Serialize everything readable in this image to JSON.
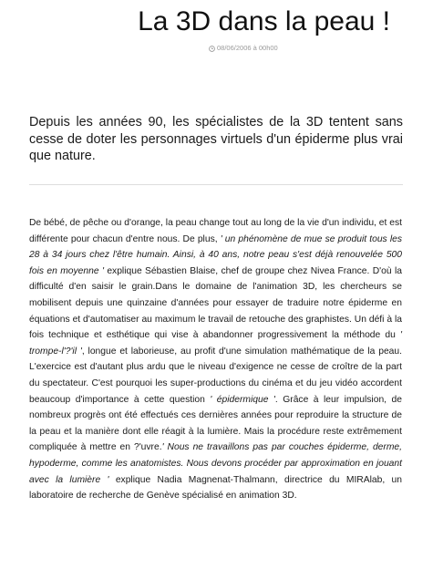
{
  "article": {
    "title": "La 3D dans la peau !",
    "date": "08/06/2006 à 00h00",
    "lead": "Depuis les années 90, les spécialistes de la 3D tentent sans cesse de doter les personnages virtuels d'un épiderme plus vrai que nature.",
    "body": {
      "p01": "De bébé, de pêche ou d'orange, la peau change tout au long de la vie d'un individu, et est différente pour chacun d'entre nous. De plus, ",
      "p02": "' un phénomène de mue se produit tous les 28 à 34 jours chez l'être humain. Ainsi, à 40 ans, notre peau s'est déjà renouvelée 500 fois en moyenne '",
      "p03": " explique Sébastien Blaise, chef de groupe chez Nivea France. D'où la difficulté d'en saisir le grain.Dans le domaine de l'animation 3D, les chercheurs se mobilisent depuis une quinzaine d'années pour essayer de traduire notre épiderme en équations et d'automatiser au maximum le travail de retouche des graphistes. Un défi à la fois technique et esthétique qui vise à abandonner progressivement la méthode du ",
      "p04": "' trompe-l'?'il '",
      "p05": ", longue et laborieuse, au profit d'une simulation mathématique de la peau. L'exercice est d'autant plus ardu que le niveau d'exigence ne cesse de croître de la part du spectateur. C'est pourquoi les super-productions du cinéma et du jeu vidéo accordent beaucoup d'importance à cette question ",
      "p06": "' épidermique '",
      "p07": ". Grâce à leur impulsion, de nombreux progrès ont été effectués ces dernières années pour reproduire la structure de la peau et la manière dont elle réagit à la lumière. Mais la procédure reste extrêmement compliquée à mettre en ?'uvre.",
      "p08": "' Nous ne travaillons pas par couches épiderme, derme, hypoderme, comme les anatomistes. Nous devons procéder par approximation en jouant avec la lumière '",
      "p09": " explique Nadia Magnenat-Thalmann, directrice du MIRAlab, un laboratoire de recherche de Genève spécialisé en animation 3D."
    }
  },
  "icons": {
    "date_icon": "clock-icon"
  },
  "colors": {
    "text": "#1a1a1a",
    "meta": "#9a9a9a",
    "divider": "#dddddd",
    "background": "#ffffff"
  }
}
